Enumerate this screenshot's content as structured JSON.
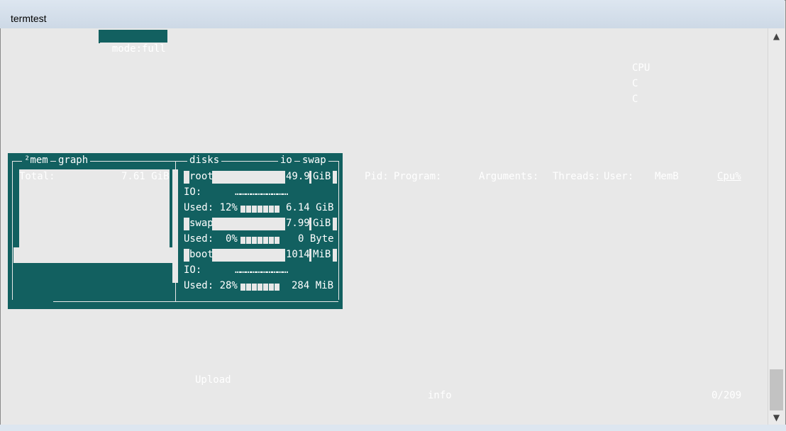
{
  "window": {
    "title": "termtest"
  },
  "top": {
    "mode": "mode:full",
    "cpu_lines": [
      "CPU",
      "C",
      "C"
    ]
  },
  "mem_panel": {
    "tabs": [
      "²mem",
      "graph"
    ],
    "total_label": "Total:",
    "total_value": "7.61 GiB"
  },
  "disks_panel": {
    "tabs": [
      "disks",
      "io",
      "swap"
    ],
    "entries": [
      {
        "name": "root",
        "size": "49.9",
        "unit": "GiB",
        "io_label": "IO:",
        "used_label": "Used: 12%",
        "used_value": "6.14 GiB"
      },
      {
        "name": "swap",
        "size": "7.99",
        "unit": "GiB",
        "io_label": "",
        "used_label": "Used:  0%",
        "used_value": "0 Byte"
      },
      {
        "name": "boot",
        "size": "1014",
        "unit": "MiB",
        "io_label": "IO:",
        "used_label": "Used: 28%",
        "used_value": "284 MiB"
      }
    ]
  },
  "proc": {
    "headers": [
      "Pid:",
      "Program:",
      "Arguments:",
      "Threads:",
      "User:",
      "MemB",
      "Cpu%"
    ]
  },
  "footer": {
    "upload": "Upload",
    "info": "info",
    "count": "0/209"
  },
  "colors": {
    "panel": "#126060",
    "bg": "#e8e8e8"
  }
}
